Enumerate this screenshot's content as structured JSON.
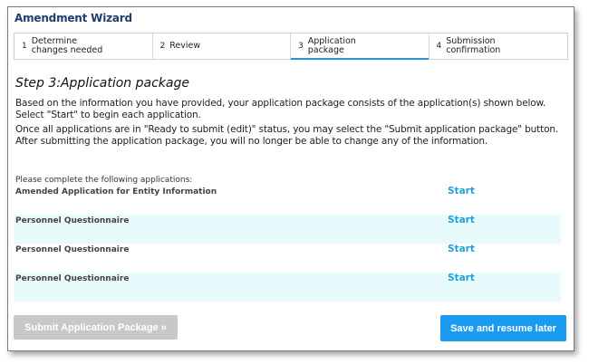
{
  "wizard": {
    "title": "Amendment Wizard"
  },
  "steps": [
    {
      "num": "1",
      "label": "Determine changes needed",
      "active": false
    },
    {
      "num": "2",
      "label": "Review",
      "active": false
    },
    {
      "num": "3",
      "label": "Application package",
      "active": true
    },
    {
      "num": "4",
      "label": "Submission confirmation",
      "active": false
    }
  ],
  "main": {
    "heading": "Step 3:Application package",
    "paragraph1": "Based on the information you have provided, your application package consists of the application(s) shown below. Select \"Start\" to begin each application.",
    "paragraph2": "Once all applications are in \"Ready to submit (edit)\" status, you may select the \"Submit application package\" button.  After submitting the application package, you will no longer be able to change any of the information.",
    "apps_caption": "Please complete the following applications:",
    "applications": [
      {
        "name": "Amended Application for Entity Information",
        "action": "Start"
      },
      {
        "name": "Personnel Questionnaire",
        "action": "Start"
      },
      {
        "name": "Personnel Questionnaire",
        "action": "Start"
      },
      {
        "name": "Personnel Questionnaire",
        "action": "Start"
      }
    ]
  },
  "footer": {
    "submit_label": "Submit Application Package »",
    "submit_enabled": false,
    "save_label": "Save and resume later"
  },
  "colors": {
    "accent": "#1b9bf0",
    "link": "#1fa1d8",
    "title": "#1f3d6e",
    "row_shade": "#e8fbfc",
    "disabled": "#c8c8c8"
  }
}
